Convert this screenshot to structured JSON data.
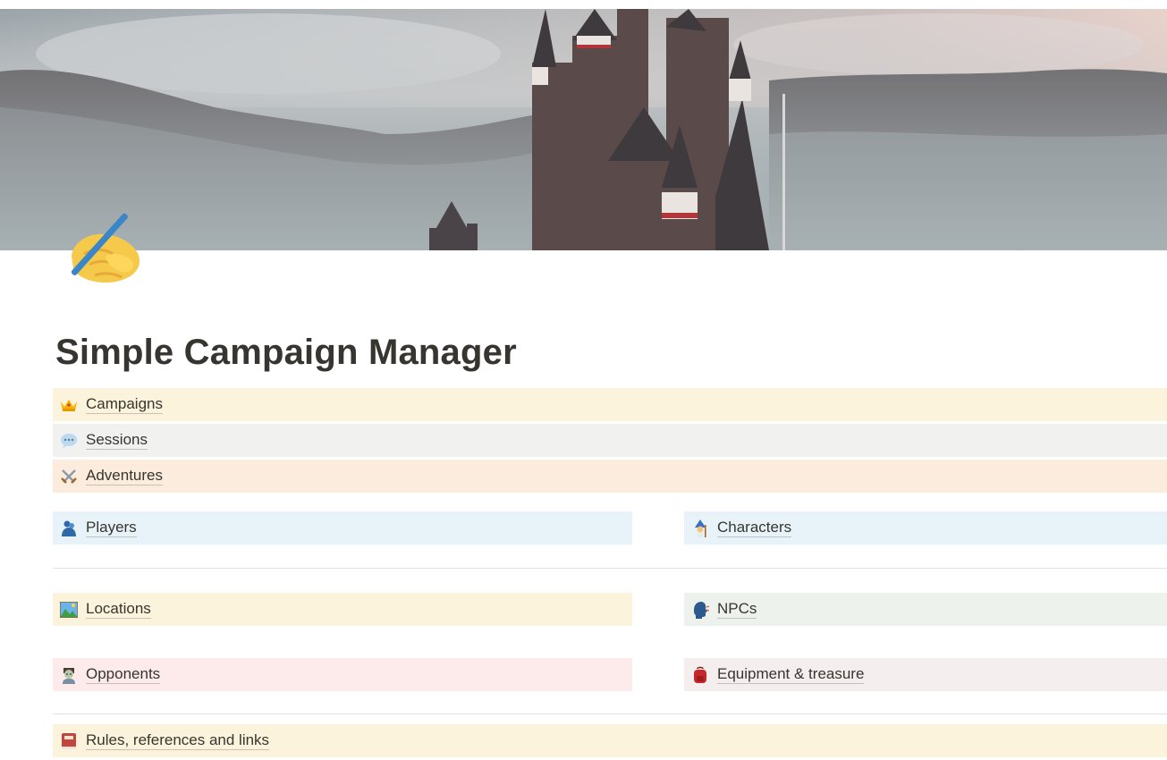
{
  "page": {
    "title": "Simple Campaign Manager",
    "icon": "writing-hand-icon",
    "cover": "castle-in-mist-cover"
  },
  "links": {
    "campaigns": {
      "label": "Campaigns",
      "icon": "crown-icon",
      "color": "#fbf3db"
    },
    "sessions": {
      "label": "Sessions",
      "icon": "speech-balloon-icon",
      "color": "#f1f1ef"
    },
    "adventures": {
      "label": "Adventures",
      "icon": "crossed-swords-icon",
      "color": "#fbecdd"
    },
    "players": {
      "label": "Players",
      "icon": "people-hugging-icon",
      "color": "#e7f3f8"
    },
    "characters": {
      "label": "Characters",
      "icon": "mage-icon",
      "color": "#e7f3f8"
    },
    "locations": {
      "label": "Locations",
      "icon": "landscape-picture-icon",
      "color": "#fbf3db"
    },
    "npcs": {
      "label": "NPCs",
      "icon": "speaking-head-icon",
      "color": "#edf3ec"
    },
    "opponents": {
      "label": "Opponents",
      "icon": "zombie-icon",
      "color": "#fdebec"
    },
    "equipment": {
      "label": "Equipment & treasure",
      "icon": "backpack-icon",
      "color": "#f4eeee"
    },
    "rules": {
      "label": "Rules, references and links",
      "icon": "closed-book-icon",
      "color": "#fbf3db"
    }
  }
}
